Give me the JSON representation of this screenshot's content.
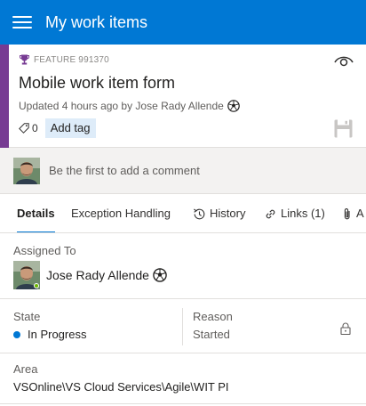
{
  "app_bar": {
    "title": "My work items"
  },
  "work_item": {
    "type_label": "FEATURE 991370",
    "title": "Mobile work item form",
    "updated_text": "Updated 4 hours ago by Jose Rady Allende",
    "tag_count": "0",
    "add_tag_label": "Add tag"
  },
  "comment": {
    "placeholder": "Be the first to add a comment"
  },
  "tabs": [
    {
      "label": "Details",
      "active": true
    },
    {
      "label": "Exception Handling",
      "active": false
    },
    {
      "label": "History",
      "icon": "history-icon",
      "active": false
    },
    {
      "label": "Links (1)",
      "icon": "link-icon",
      "active": false
    },
    {
      "label": "A",
      "icon": "attachment-icon",
      "active": false
    }
  ],
  "fields": {
    "assigned_to": {
      "label": "Assigned To",
      "value": "Jose Rady Allende"
    },
    "state": {
      "label": "State",
      "value": "In Progress"
    },
    "reason": {
      "label": "Reason",
      "value": "Started"
    },
    "area": {
      "label": "Area",
      "value": "VSOnline\\VS Cloud Services\\Agile\\WIT PI"
    }
  },
  "colors": {
    "accent": "#0078d4",
    "feature": "#773b93",
    "in_progress": "#0078d4",
    "add_tag_bg": "#deecf9"
  },
  "icons": [
    "menu-icon",
    "trophy-icon",
    "eye-icon",
    "soccer-ball-icon",
    "tag-icon",
    "save-icon",
    "history-icon",
    "link-icon",
    "attachment-icon",
    "lock-icon"
  ]
}
